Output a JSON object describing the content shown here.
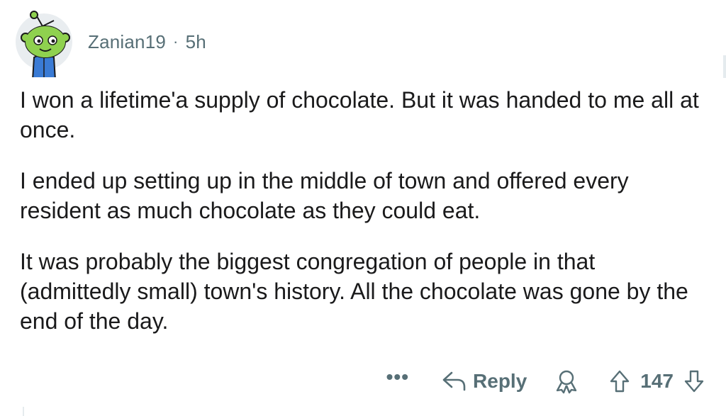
{
  "comment": {
    "author": "Zanian19",
    "separator": "·",
    "age": "5h",
    "paragraphs": [
      "I won a lifetime'a supply of chocolate. But it was handed to me all at once.",
      "I ended up setting up in the middle of town and offered every resident as much chocolate as they could eat.",
      "It was probably the biggest congregation of people in that (admittedly small) town's history. All the chocolate was gone by the end of the day."
    ]
  },
  "actions": {
    "more": "•••",
    "reply_label": "Reply",
    "score": "147",
    "icons": {
      "reply": "reply-arrow-icon",
      "award": "award-icon",
      "upvote": "upvote-arrow-icon",
      "downvote": "downvote-arrow-icon"
    }
  },
  "colors": {
    "text": "#1a1a1b",
    "meta": "#576f76",
    "avatar_green": "#8fd14f"
  }
}
